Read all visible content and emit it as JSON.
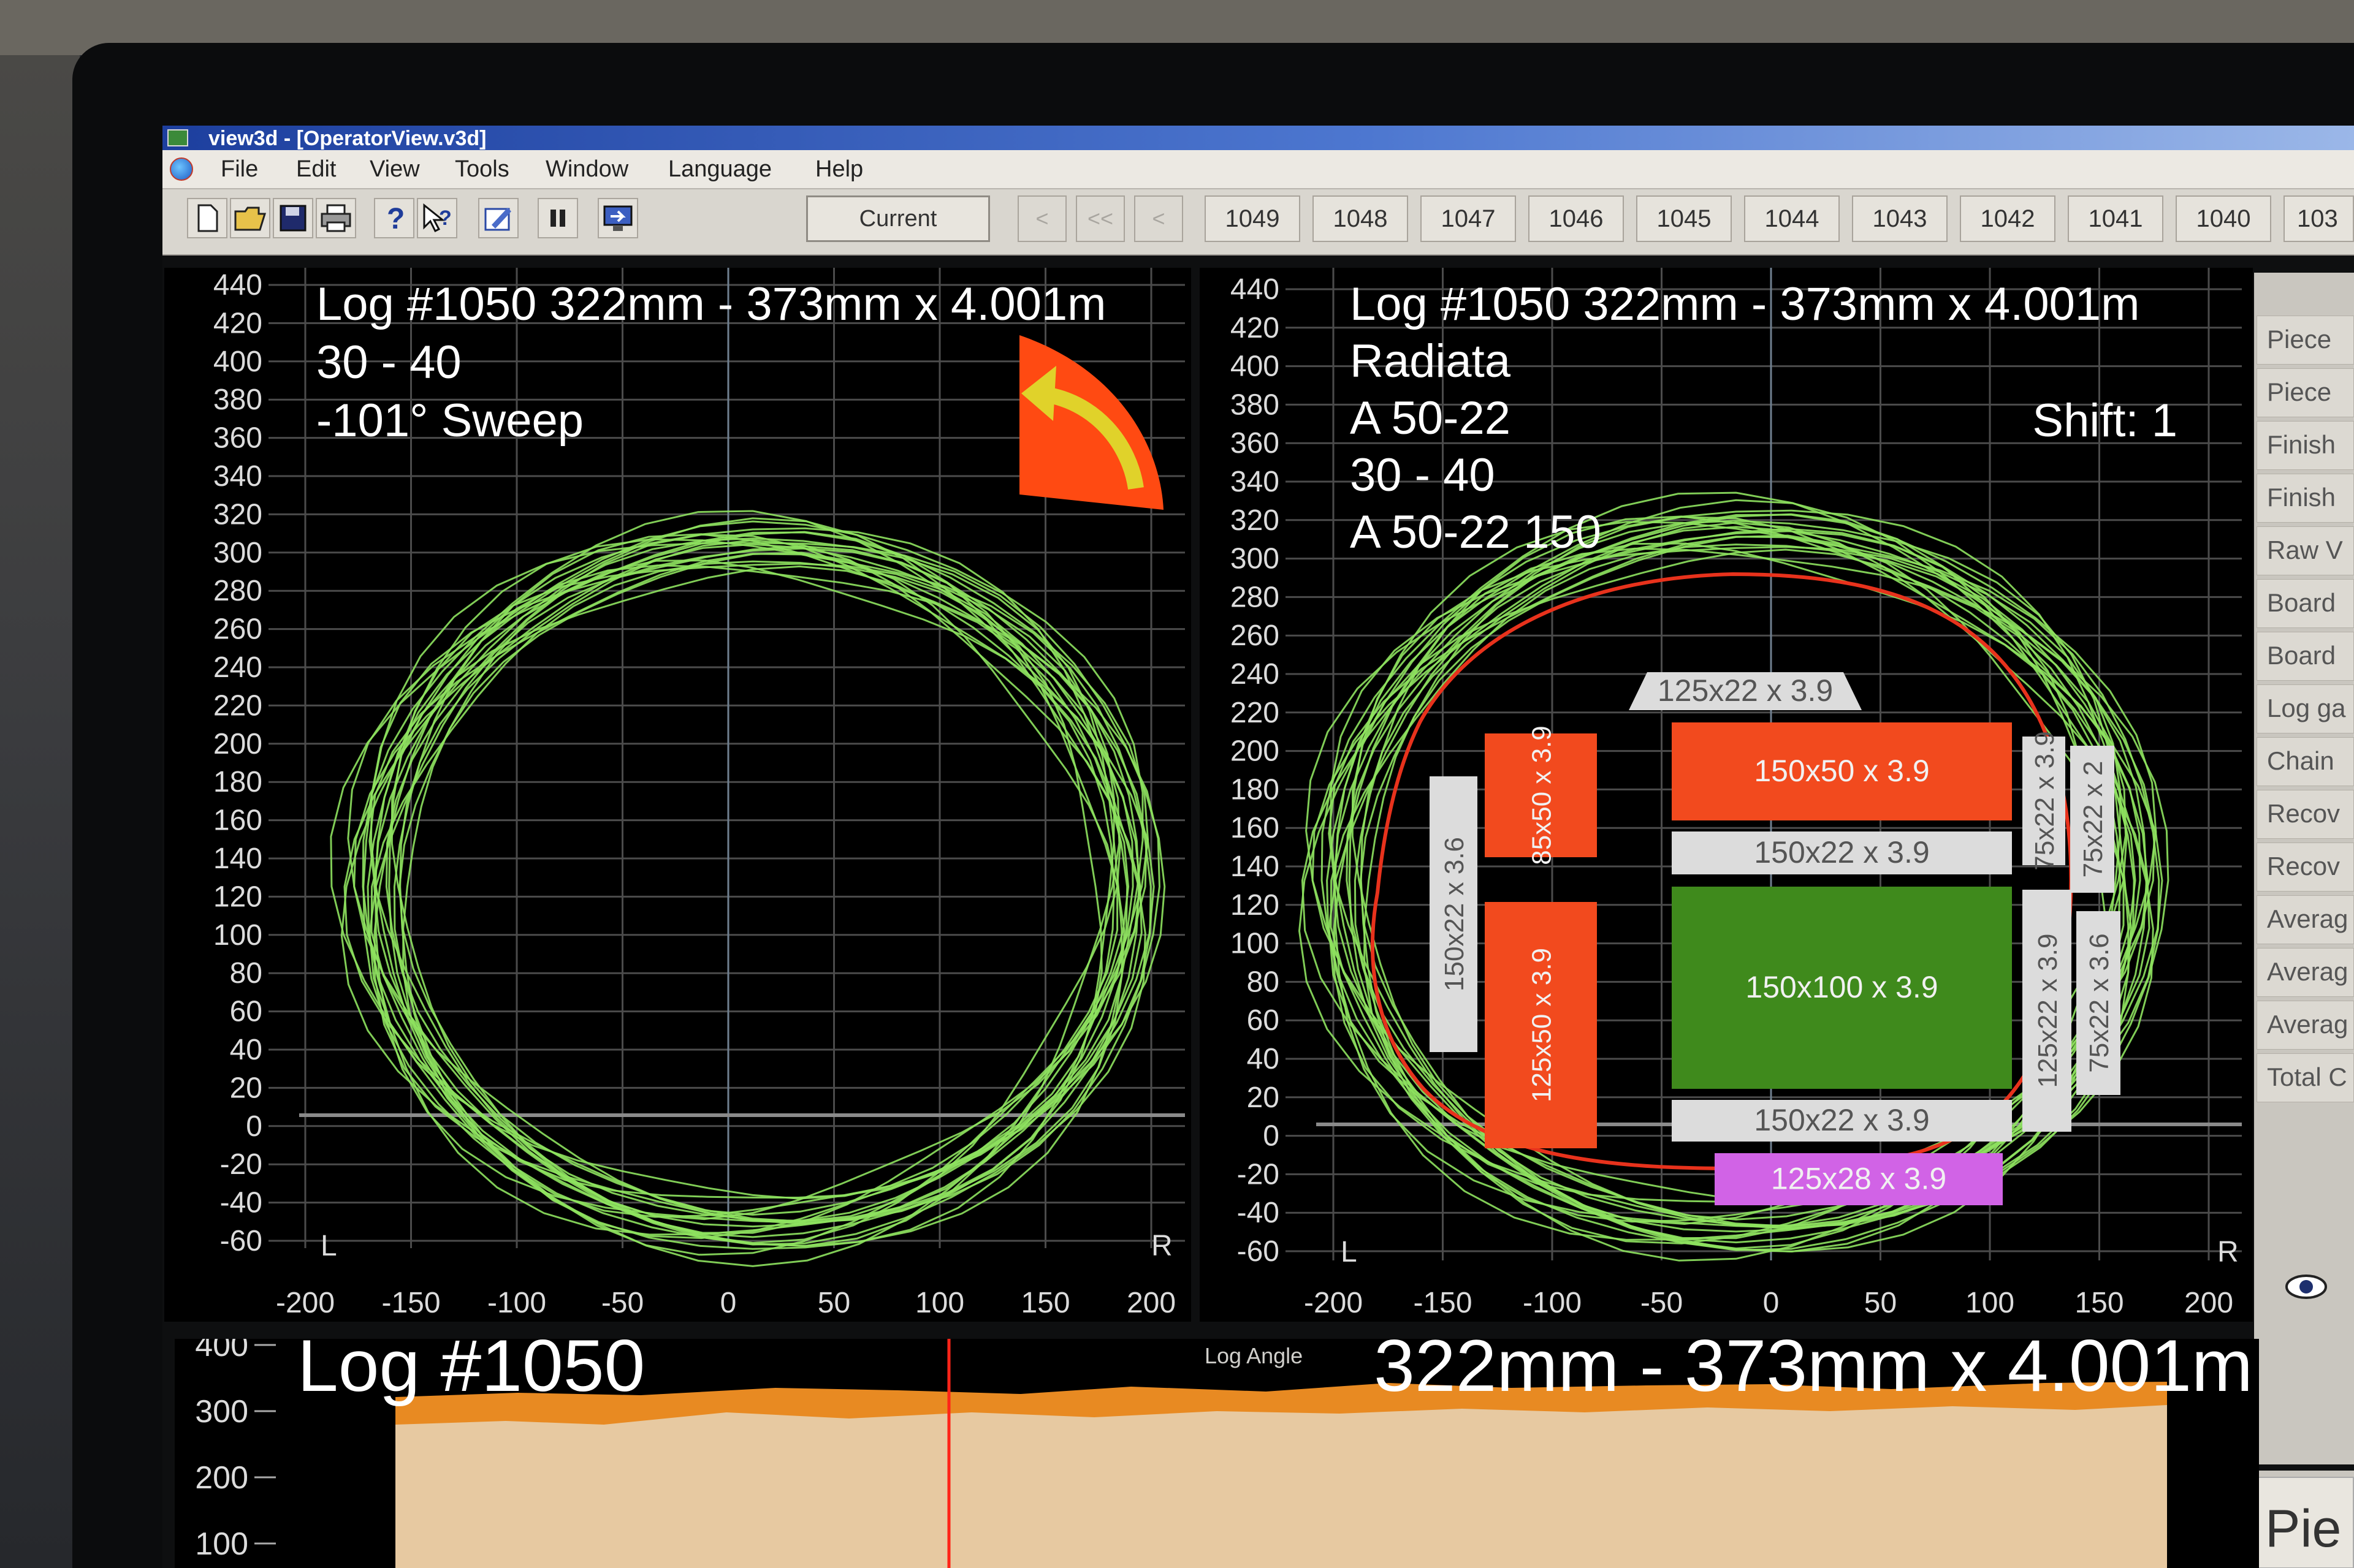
{
  "window": {
    "title": "view3d - [OperatorView.v3d]",
    "menu": [
      "File",
      "Edit",
      "View",
      "Tools",
      "Window",
      "Language",
      "Help"
    ]
  },
  "toolbar": {
    "icons": [
      "new-file-icon",
      "open-folder-icon",
      "save-icon",
      "print-icon",
      "help-icon",
      "context-help-icon",
      "edit-icon",
      "pause-icon",
      "monitor-icon"
    ],
    "current_label": "Current",
    "nav": [
      "<",
      "<<",
      "<"
    ],
    "log_buttons": [
      "1049",
      "1048",
      "1047",
      "1046",
      "1045",
      "1044",
      "1043",
      "1042",
      "1041",
      "1040",
      "103"
    ]
  },
  "left_plot": {
    "header_lines": [
      "Log #1050 322mm - 373mm x 4.001m",
      "30 - 40",
      "-101° Sweep"
    ],
    "y_ticks": [
      "440",
      "420",
      "400",
      "380",
      "360",
      "340",
      "320",
      "300",
      "280",
      "260",
      "240",
      "220",
      "200",
      "180",
      "160",
      "140",
      "120",
      "100",
      "80",
      "60",
      "40",
      "20",
      "0",
      "-20",
      "-40",
      "-60"
    ],
    "x_ticks": [
      "-200",
      "-150",
      "-100",
      "-50",
      "0",
      "50",
      "100",
      "150",
      "200"
    ],
    "left_marker": "L",
    "right_marker": "R",
    "rotation_icon": "rotate-arrow-icon"
  },
  "right_plot": {
    "header_lines": [
      "Log #1050 322mm - 373mm x 4.001m",
      "Radiata",
      "A 50-22",
      "30 - 40",
      "A 50-22 150"
    ],
    "shift": "Shift:  1",
    "y_ticks": [
      "440",
      "420",
      "400",
      "380",
      "360",
      "340",
      "320",
      "300",
      "280",
      "260",
      "240",
      "220",
      "200",
      "180",
      "160",
      "140",
      "120",
      "100",
      "80",
      "60",
      "40",
      "20",
      "0",
      "-20",
      "-40",
      "-60"
    ],
    "x_ticks": [
      "-200",
      "-150",
      "-100",
      "-50",
      "0",
      "50",
      "100",
      "150",
      "200"
    ],
    "left_marker": "L",
    "right_marker": "R",
    "boards": [
      {
        "label": "125x22 x 3.9",
        "color": "#dcdcdc"
      },
      {
        "label": "150x50 x 3.9",
        "color": "#f24a1e"
      },
      {
        "label": "150x22 x 3.9",
        "color": "#dcdcdc"
      },
      {
        "label": "150x100 x 3.9",
        "color": "#3f8a1c"
      },
      {
        "label": "150x22 x 3.9",
        "color": "#dcdcdc"
      },
      {
        "label": "125x28 x 3.9",
        "color": "#d163e6"
      },
      {
        "label": "150x22 x 3.6",
        "color": "#dcdcdc"
      },
      {
        "label": "85x50 x 3.9",
        "color": "#f24a1e"
      },
      {
        "label": "125x50 x 3.9",
        "color": "#f24a1e"
      },
      {
        "label": "75x22 x 3.9",
        "color": "#dcdcdc"
      },
      {
        "label": "75x22 x 2",
        "color": "#dcdcdc"
      },
      {
        "label": "125x22 x 3.9",
        "color": "#dcdcdc"
      },
      {
        "label": "75x22 x 3.6",
        "color": "#dcdcdc"
      }
    ]
  },
  "side_labels": [
    "Piece",
    "Piece",
    "Finish",
    "Finish",
    "Raw V",
    "Board",
    "Board",
    "Log ga",
    "Chain",
    "Recov",
    "Recov",
    "Averag",
    "Averag",
    "Averag",
    "Total C"
  ],
  "side_bottom_label": "Pie",
  "bottom_plot": {
    "title": "Log #1050",
    "dims": "322mm - 373mm x 4.001m",
    "y_ticks": [
      "400",
      "300",
      "200",
      "100"
    ],
    "faint_label": "Log Angle"
  }
}
